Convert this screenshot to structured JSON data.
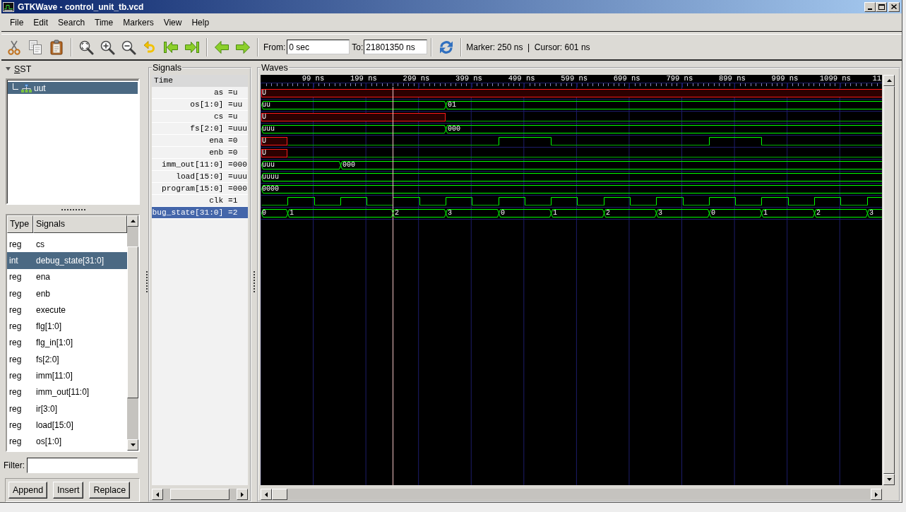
{
  "window": {
    "title": "GTKWave - control_unit_tb.vcd"
  },
  "menu": [
    "File",
    "Edit",
    "Search",
    "Time",
    "Markers",
    "View",
    "Help"
  ],
  "toolbar": {
    "from_label": "From:",
    "from_value": "0 sec",
    "to_label": "To:",
    "to_value": "21801350 ns",
    "status": "Marker: 250 ns  |  Cursor: 601 ns"
  },
  "sst_pane": {
    "title": "SST",
    "expanded": true,
    "tree": [
      {
        "label": "uut",
        "selected": true
      }
    ],
    "signal_list": {
      "columns": [
        "Type",
        "Signals"
      ],
      "rows": [
        {
          "type": "reg",
          "name": "cs",
          "selected": false
        },
        {
          "type": "int",
          "name": "debug_state[31:0]",
          "selected": true
        },
        {
          "type": "reg",
          "name": "ena",
          "selected": false
        },
        {
          "type": "reg",
          "name": "enb",
          "selected": false
        },
        {
          "type": "reg",
          "name": "execute",
          "selected": false
        },
        {
          "type": "reg",
          "name": "flg[1:0]",
          "selected": false
        },
        {
          "type": "reg",
          "name": "flg_in[1:0]",
          "selected": false
        },
        {
          "type": "reg",
          "name": "fs[2:0]",
          "selected": false
        },
        {
          "type": "reg",
          "name": "imm[11:0]",
          "selected": false
        },
        {
          "type": "reg",
          "name": "imm_out[11:0]",
          "selected": false
        },
        {
          "type": "reg",
          "name": "ir[3:0]",
          "selected": false
        },
        {
          "type": "reg",
          "name": "load[15:0]",
          "selected": false
        },
        {
          "type": "reg",
          "name": "os[1:0]",
          "selected": false
        }
      ]
    },
    "filter_label": "Filter:",
    "buttons": [
      "Append",
      "Insert",
      "Replace"
    ]
  },
  "signals_pane": {
    "title": "Signals",
    "header": "Time",
    "rows": [
      {
        "name": "as",
        "value": "=u",
        "selected": false
      },
      {
        "name": "os[1:0]",
        "value": "=uu",
        "selected": false
      },
      {
        "name": "cs",
        "value": "=u",
        "selected": false
      },
      {
        "name": "fs[2:0]",
        "value": "=uuu",
        "selected": false
      },
      {
        "name": "ena",
        "value": "=0",
        "selected": false
      },
      {
        "name": "enb",
        "value": "=0",
        "selected": false
      },
      {
        "name": "imm_out[11:0]",
        "value": "=000",
        "selected": false
      },
      {
        "name": "load[15:0]",
        "value": "=uuu",
        "selected": false
      },
      {
        "name": "program[15:0]",
        "value": "=000",
        "selected": false
      },
      {
        "name": "clk",
        "value": "=1",
        "selected": false
      },
      {
        "name": "bug_state[31:0]",
        "value": "=2",
        "selected": true
      }
    ]
  },
  "waves_pane": {
    "title": "Waves",
    "ruler_labels": [
      "99 ns",
      "199 ns",
      "299 ns",
      "399 ns",
      "499 ns",
      "599 ns",
      "699 ns",
      "799 ns",
      "899 ns",
      "999 ns",
      "1099 ns",
      "11"
    ],
    "traces": [
      {
        "kind": "bit",
        "segments": [
          {
            "kind": "unknown",
            "label": "U"
          }
        ]
      },
      {
        "kind": "bus",
        "segments": [
          {
            "kind": "value",
            "label": "uu"
          },
          {
            "kind": "value",
            "label": "01"
          }
        ]
      },
      {
        "kind": "bit",
        "segments": [
          {
            "kind": "unknown",
            "label": "U"
          }
        ]
      },
      {
        "kind": "bus",
        "segments": [
          {
            "kind": "value",
            "label": "uuu"
          },
          {
            "kind": "value",
            "label": "000"
          }
        ]
      },
      {
        "kind": "bit",
        "segments": [
          {
            "kind": "unknown",
            "label": "U"
          }
        ]
      },
      {
        "kind": "bit",
        "segments": [
          {
            "kind": "unknown",
            "label": "U"
          }
        ]
      },
      {
        "kind": "bus",
        "segments": [
          {
            "kind": "value",
            "label": "uuu"
          },
          {
            "kind": "value",
            "label": "000"
          }
        ]
      },
      {
        "kind": "bus",
        "segments": [
          {
            "kind": "value",
            "label": "uuuu"
          }
        ]
      },
      {
        "kind": "bus",
        "segments": [
          {
            "kind": "value",
            "label": "0000"
          }
        ]
      },
      {
        "kind": "bit"
      },
      {
        "kind": "bus",
        "segments": [
          {
            "kind": "value",
            "label": "0"
          },
          {
            "kind": "value",
            "label": "1"
          },
          {
            "kind": "value",
            "label": "2"
          },
          {
            "kind": "value",
            "label": "3"
          },
          {
            "kind": "value",
            "label": "0"
          },
          {
            "kind": "value",
            "label": "1"
          },
          {
            "kind": "value",
            "label": "2"
          },
          {
            "kind": "value",
            "label": "3"
          },
          {
            "kind": "value",
            "label": "0"
          },
          {
            "kind": "value",
            "label": "1"
          },
          {
            "kind": "value",
            "label": "2"
          },
          {
            "kind": "value",
            "label": "3"
          }
        ]
      }
    ]
  }
}
